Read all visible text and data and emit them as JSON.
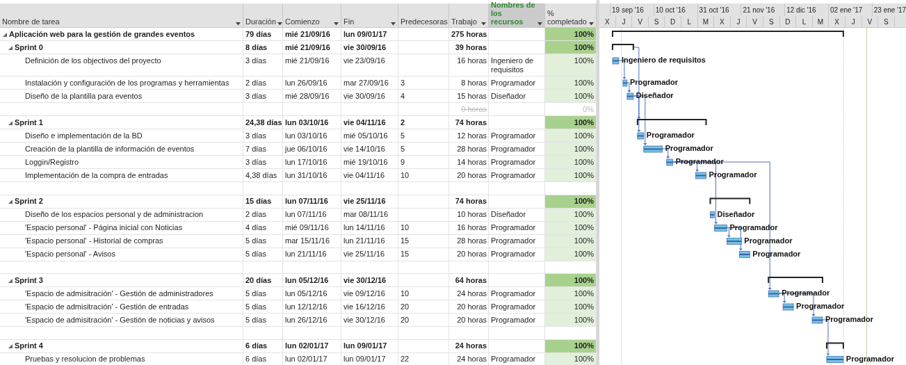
{
  "columns": [
    {
      "label": "Nombre de tarea",
      "selected": false
    },
    {
      "label": "Duración",
      "selected": false
    },
    {
      "label": "Comienzo",
      "selected": false
    },
    {
      "label": "Fin",
      "selected": false
    },
    {
      "label": "Predecesoras",
      "selected": false
    },
    {
      "label": "Trabajo",
      "selected": false
    },
    {
      "label": "Nombres de los recursos",
      "selected": true
    },
    {
      "label": "% completado",
      "selected": false
    }
  ],
  "timescale": {
    "top": [
      "19 sep '16",
      "10 oct '16",
      "31 oct '16",
      "21 nov '16",
      "12 dic '16",
      "02 ene '17",
      "23 ene '17"
    ],
    "bottom": [
      "X",
      "J",
      "V",
      "S",
      "D",
      "L",
      "M",
      "X",
      "J",
      "V",
      "S",
      "D",
      "L",
      "M",
      "X",
      "J",
      "V",
      "S"
    ]
  },
  "tasks": [
    {
      "kind": "summary",
      "expanded": true,
      "name": "Aplicación web para la gestión de grandes eventos",
      "duration": "79 días",
      "start": "mié 21/09/16",
      "finish": "lun 09/01/17",
      "work": "275 horas",
      "complete": "100%",
      "children": [
        {
          "kind": "summary",
          "expanded": true,
          "name": "Sprint 0",
          "duration": "8 días",
          "start": "mié 21/09/16",
          "finish": "vie 30/09/16",
          "work": "39 horas",
          "complete": "100%",
          "children": [
            {
              "kind": "task",
              "name": "Definición de los objectivos del proyecto",
              "duration": "3 días",
              "start": "mié 21/09/16",
              "finish": "vie 23/09/16",
              "work": "16 horas",
              "resources": "Ingeniero de requisitos",
              "complete": "100%",
              "bar_label": "Ingeniero de requisitos"
            },
            {
              "kind": "task",
              "name": "Instalación y configuración de los programas y herramientas",
              "duration": "2 días",
              "start": "lun 26/09/16",
              "finish": "mar 27/09/16",
              "predecessors": "3",
              "work": "8 horas",
              "resources": "Programador",
              "complete": "100%",
              "bar_label": "Programador"
            },
            {
              "kind": "task",
              "name": "Diseño de la plantilla para eventos",
              "duration": "3 días",
              "start": "mié 28/09/16",
              "finish": "vie 30/09/16",
              "predecessors": "4",
              "work": "15 horas",
              "resources": "Diseñador",
              "complete": "100%",
              "bar_label": "Diseñador"
            },
            {
              "kind": "empty",
              "work": "0 horas",
              "complete": "0%"
            }
          ]
        },
        {
          "kind": "summary",
          "expanded": true,
          "name": "Sprint 1",
          "duration": "24,38 días",
          "start": "lun 03/10/16",
          "finish": "vie 04/11/16",
          "predecessors": "2",
          "work": "74 horas",
          "complete": "100%",
          "children": [
            {
              "kind": "task",
              "name": "Diseño e implementación de la BD",
              "duration": "3 días",
              "start": "lun 03/10/16",
              "finish": "mié 05/10/16",
              "predecessors": "5",
              "work": "12 horas",
              "resources": "Programador",
              "complete": "100%",
              "bar_label": "Programador"
            },
            {
              "kind": "task",
              "name": "Creación de la plantilla de información de eventos",
              "duration": "7 días",
              "start": "jue 06/10/16",
              "finish": "vie 14/10/16",
              "predecessors": "5",
              "work": "28 horas",
              "resources": "Programador",
              "complete": "100%",
              "bar_label": "Programador"
            },
            {
              "kind": "task",
              "name": "Loggin/Registro",
              "duration": "3 días",
              "start": "lun 17/10/16",
              "finish": "mié 19/10/16",
              "predecessors": "9",
              "work": "14 horas",
              "resources": "Programador",
              "complete": "100%",
              "bar_label": "Programador"
            },
            {
              "kind": "task",
              "name": "Implementación de la compra de entradas",
              "duration": "4,38 días",
              "start": "lun 31/10/16",
              "finish": "vie 04/11/16",
              "predecessors": "10",
              "work": "20 horas",
              "resources": "Programador",
              "complete": "100%",
              "bar_label": "Programador"
            },
            {
              "kind": "blank"
            }
          ]
        },
        {
          "kind": "summary",
          "expanded": true,
          "name": "Sprint 2",
          "duration": "15 días",
          "start": "lun 07/11/16",
          "finish": "vie 25/11/16",
          "work": "74 horas",
          "complete": "100%",
          "children": [
            {
              "kind": "task",
              "name": "Diseño de los espacios personal y de administracion",
              "duration": "2 días",
              "start": "lun 07/11/16",
              "finish": "mar 08/11/16",
              "work": "10 horas",
              "resources": "Diseñador",
              "complete": "100%",
              "bar_label": "Diseñador"
            },
            {
              "kind": "task",
              "name": "'Espacio personal' - Página inicial con Noticias",
              "duration": "4 días",
              "start": "mié 09/11/16",
              "finish": "lun 14/11/16",
              "predecessors": "10",
              "work": "16 horas",
              "resources": "Programador",
              "complete": "100%",
              "bar_label": "Programador"
            },
            {
              "kind": "task",
              "name": "'Espacio personal' - Historial de compras",
              "duration": "5 días",
              "start": "mar 15/11/16",
              "finish": "lun 21/11/16",
              "predecessors": "15",
              "work": "28 horas",
              "resources": "Programador",
              "complete": "100%",
              "bar_label": "Programador"
            },
            {
              "kind": "task",
              "name": "'Espacio personal' - Avisos",
              "duration": "5 días",
              "start": "lun 21/11/16",
              "finish": "vie 25/11/16",
              "predecessors": "15",
              "work": "20 horas",
              "resources": "Programador",
              "complete": "100%",
              "bar_label": "Programador"
            },
            {
              "kind": "blank"
            }
          ]
        },
        {
          "kind": "summary",
          "expanded": true,
          "name": "Sprint 3",
          "duration": "20 días",
          "start": "lun 05/12/16",
          "finish": "vie 30/12/16",
          "work": "64 horas",
          "complete": "100%",
          "children": [
            {
              "kind": "task",
              "name": "'Espacio de admisitración' - Gestión de administradores",
              "duration": "5 días",
              "start": "lun 05/12/16",
              "finish": "vie 09/12/16",
              "predecessors": "10",
              "work": "24 horas",
              "resources": "Programador",
              "complete": "100%",
              "bar_label": "Programador"
            },
            {
              "kind": "task",
              "name": "'Espacio de admisitración' - Gestión de entradas",
              "duration": "5 días",
              "start": "lun 12/12/16",
              "finish": "vie 16/12/16",
              "predecessors": "20",
              "work": "20 horas",
              "resources": "Programador",
              "complete": "100%",
              "bar_label": "Programador"
            },
            {
              "kind": "task",
              "name": "'Espacio de admisitración' - Gestión de noticias y avisos",
              "duration": "5 días",
              "start": "lun 26/12/16",
              "finish": "vie 30/12/16",
              "predecessors": "20",
              "work": "20 horas",
              "resources": "Programador",
              "complete": "100%",
              "bar_label": "Programador"
            },
            {
              "kind": "blank"
            }
          ]
        },
        {
          "kind": "summary",
          "expanded": true,
          "name": "Sprint 4",
          "duration": "6 días",
          "start": "lun 02/01/17",
          "finish": "lun 09/01/17",
          "work": "24 horas",
          "complete": "100%",
          "children": [
            {
              "kind": "task",
              "name": "Pruebas y resolucion de problemas",
              "duration": "6 días",
              "start": "lun 02/01/17",
              "finish": "lun 09/01/17",
              "predecessors": "22",
              "work": "24 horas",
              "resources": "Programador",
              "complete": "100%",
              "bar_label": "Programador"
            }
          ]
        }
      ]
    }
  ]
}
